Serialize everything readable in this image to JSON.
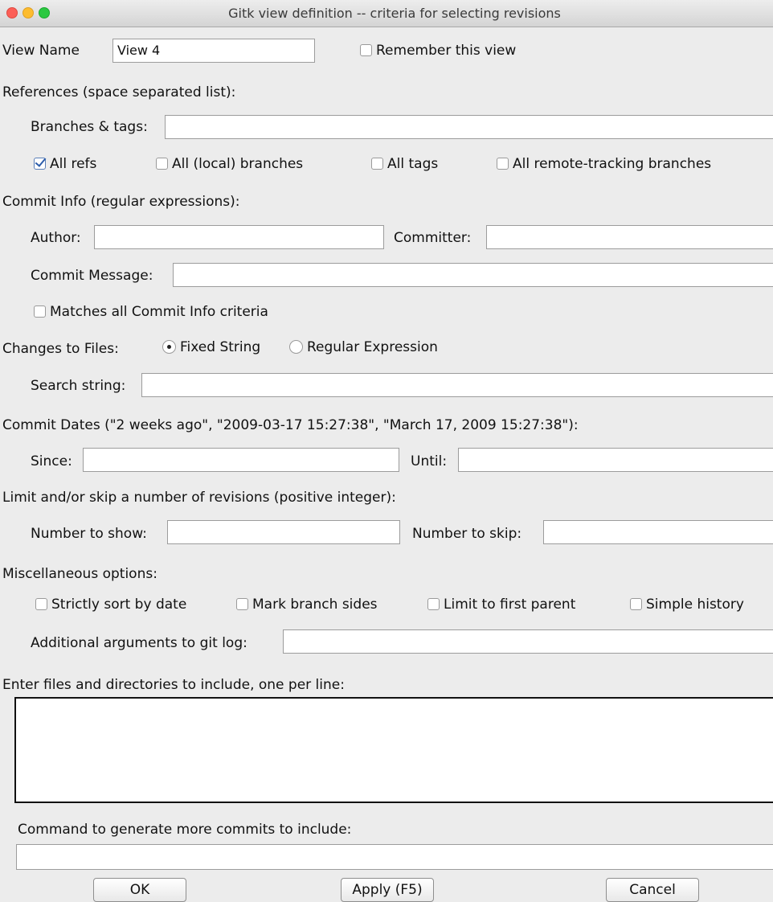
{
  "window": {
    "title": "Gitk view definition -- criteria for selecting revisions"
  },
  "view": {
    "name_label": "View Name",
    "name_value": "View 4",
    "remember_label": "Remember this view",
    "remember_checked": false
  },
  "references": {
    "heading": "References (space separated list):",
    "branches_label": "Branches & tags:",
    "branches_value": "",
    "all_refs": "All refs",
    "all_local": "All (local) branches",
    "all_tags": "All tags",
    "all_remote": "All remote-tracking branches"
  },
  "commit_info": {
    "heading": "Commit Info (regular expressions):",
    "author_label": "Author:",
    "committer_label": "Committer:",
    "message_label": "Commit Message:",
    "matches_all": "Matches all Commit Info criteria"
  },
  "changes": {
    "label": "Changes to Files:",
    "fixed": "Fixed String",
    "regex": "Regular Expression",
    "search_label": "Search string:"
  },
  "dates": {
    "heading": "Commit Dates (\"2 weeks ago\", \"2009-03-17 15:27:38\", \"March 17, 2009 15:27:38\"):",
    "since_label": "Since:",
    "until_label": "Until:"
  },
  "limit": {
    "heading": "Limit and/or skip a number of revisions (positive integer):",
    "show_label": "Number to show:",
    "skip_label": "Number to skip:"
  },
  "misc": {
    "heading": "Miscellaneous options:",
    "strict_sort": "Strictly sort by date",
    "mark_sides": "Mark branch sides",
    "first_parent": "Limit to first parent",
    "simple_history": "Simple history",
    "args_label": "Additional arguments to git log:"
  },
  "files": {
    "heading": "Enter files and directories to include, one per line:"
  },
  "command": {
    "heading": "Command to generate more commits to include:"
  },
  "buttons": {
    "ok": "OK",
    "apply": "Apply (F5)",
    "cancel": "Cancel"
  }
}
